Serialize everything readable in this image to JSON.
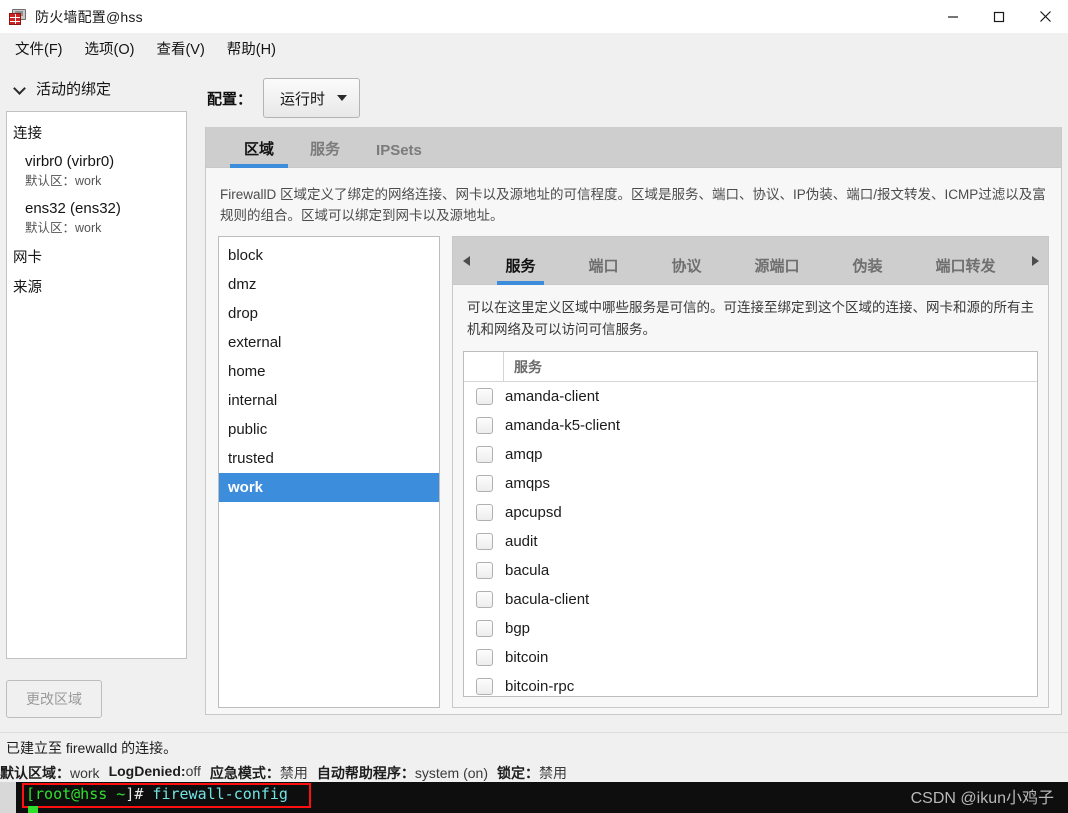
{
  "window": {
    "title": "防火墙配置@hss",
    "icon": "firewall-icon",
    "minimize": "—",
    "maximize": "□",
    "close": "✕"
  },
  "menubar": {
    "items": [
      {
        "label": "文件(F)",
        "name": "menu-file"
      },
      {
        "label": "选项(O)",
        "name": "menu-options"
      },
      {
        "label": "查看(V)",
        "name": "menu-view"
      },
      {
        "label": "帮助(H)",
        "name": "menu-help"
      }
    ]
  },
  "sidebar": {
    "collapse_label": "活动的绑定",
    "connections_header": "连接",
    "connections": [
      {
        "name": "virbr0 (virbr0)",
        "sub": "默认区：work"
      },
      {
        "name": "ens32 (ens32)",
        "sub": "默认区：work"
      }
    ],
    "interfaces_label": "网卡",
    "sources_label": "来源",
    "change_zone_button": "更改区域"
  },
  "config": {
    "label": "配置：",
    "selected": "运行时"
  },
  "outer_tabs": [
    {
      "label": "区域",
      "active": true
    },
    {
      "label": "服务",
      "active": false
    },
    {
      "label": "IPSets",
      "active": false
    }
  ],
  "zone_description": "FirewallD 区域定义了绑定的网络连接、网卡以及源地址的可信程度。区域是服务、端口、协议、IP伪装、端口/报文转发、ICMP过滤以及富规则的组合。区域可以绑定到网卡以及源地址。",
  "zones": [
    {
      "name": "block",
      "selected": false
    },
    {
      "name": "dmz",
      "selected": false
    },
    {
      "name": "drop",
      "selected": false
    },
    {
      "name": "external",
      "selected": false
    },
    {
      "name": "home",
      "selected": false
    },
    {
      "name": "internal",
      "selected": false
    },
    {
      "name": "public",
      "selected": false
    },
    {
      "name": "trusted",
      "selected": false
    },
    {
      "name": "work",
      "selected": true
    }
  ],
  "inner_tabs": {
    "scroll_left": "◀",
    "scroll_right": "▶",
    "items": [
      {
        "label": "服务",
        "active": true
      },
      {
        "label": "端口",
        "active": false
      },
      {
        "label": "协议",
        "active": false
      },
      {
        "label": "源端口",
        "active": false
      },
      {
        "label": "伪装",
        "active": false
      },
      {
        "label": "端口转发",
        "active": false
      }
    ]
  },
  "service_description": "可以在这里定义区域中哪些服务是可信的。可连接至绑定到这个区域的连接、网卡和源的所有主机和网络及可以访问可信服务。",
  "service_table": {
    "header": "服务",
    "rows": [
      {
        "name": "amanda-client",
        "checked": false
      },
      {
        "name": "amanda-k5-client",
        "checked": false
      },
      {
        "name": "amqp",
        "checked": false
      },
      {
        "name": "amqps",
        "checked": false
      },
      {
        "name": "apcupsd",
        "checked": false
      },
      {
        "name": "audit",
        "checked": false
      },
      {
        "name": "bacula",
        "checked": false
      },
      {
        "name": "bacula-client",
        "checked": false
      },
      {
        "name": "bgp",
        "checked": false
      },
      {
        "name": "bitcoin",
        "checked": false
      },
      {
        "name": "bitcoin-rpc",
        "checked": false
      }
    ]
  },
  "statusbar": {
    "connection_message": "已建立至 firewalld 的连接。",
    "fields": [
      {
        "key": "默认区域：",
        "value": "work"
      },
      {
        "key": "LogDenied:",
        "value": "off"
      },
      {
        "key": "应急模式：",
        "value": "禁用"
      },
      {
        "key": "自动帮助程序：",
        "value": "system (on)"
      },
      {
        "key": "锁定：",
        "value": "禁用"
      }
    ]
  },
  "terminal": {
    "prompt_bracket_open": "[",
    "user_host": "root@hss",
    "path": " ~",
    "prompt_bracket_close": "]#",
    "command": " firewall-config"
  },
  "watermark": {
    "line1": "CSDN @ikun小鸡子",
    "line2": ""
  },
  "colors": {
    "accent": "#3c8edd",
    "tabstrip": "#cecece",
    "window_bg": "#f0f0f0",
    "terminal_bg": "#0e0e0e",
    "terminal_green": "#2fe02f",
    "terminal_cyan": "#6fe3e3",
    "highlight_box": "#ff0f0f"
  }
}
